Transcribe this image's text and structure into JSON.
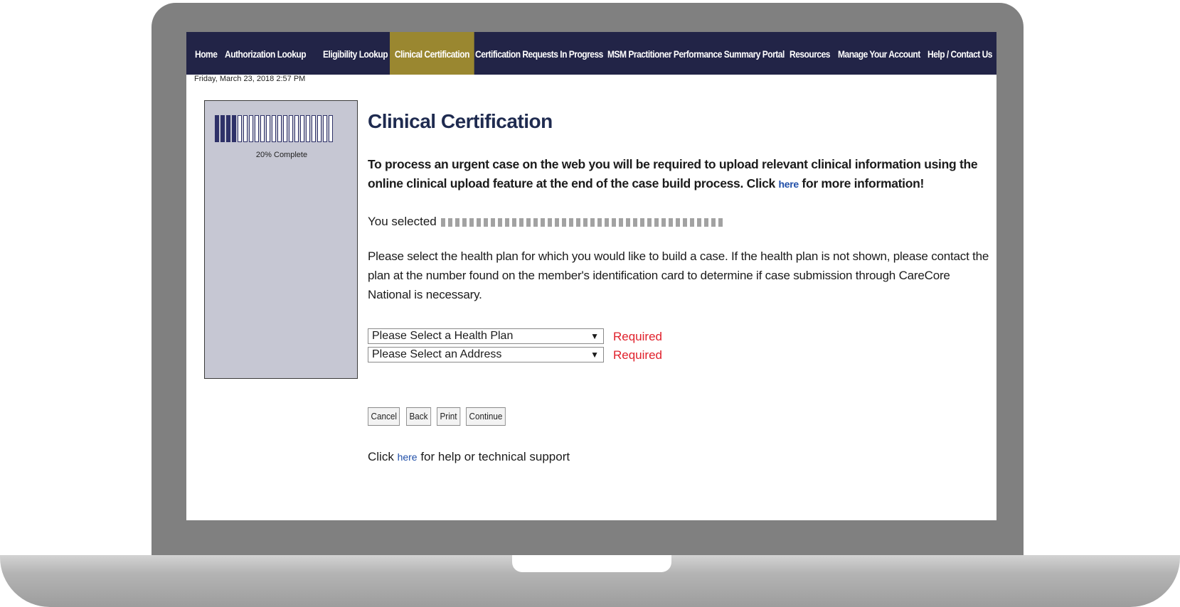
{
  "nav": {
    "items": [
      {
        "label": "Home",
        "active": false
      },
      {
        "label": "Authorization Lookup",
        "active": false
      },
      {
        "label": "Eligibility Lookup",
        "active": false
      },
      {
        "label": "Clinical Certification",
        "active": true
      },
      {
        "label": "Certification Requests In Progress",
        "active": false
      },
      {
        "label": "MSM Practitioner Performance Summary Portal",
        "active": false
      },
      {
        "label": "Resources",
        "active": false
      },
      {
        "label": "Manage Your Account",
        "active": false
      },
      {
        "label": "Help / Contact Us",
        "active": false
      }
    ]
  },
  "datetime": "Friday, March 23, 2018 2:57 PM",
  "progress": {
    "label": "20% Complete",
    "percent": 20,
    "total_segments": 21,
    "filled_segments": 4
  },
  "main": {
    "title": "Clinical Certification",
    "notice_before": "To process an urgent case on the web you will be required to upload relevant clinical information using the online clinical upload feature at the end of the case build process. Click ",
    "notice_link": "here",
    "notice_after": " for more information!",
    "selected_prefix": "You selected",
    "instructions": "Please select the health plan for which you would like to build a case. If the health plan is not shown, please contact the plan at the number found on the member's identification card to determine if case submission through CareCore National is necessary.",
    "health_plan_select": {
      "value": "Please Select a Health Plan",
      "required": "Required"
    },
    "address_select": {
      "value": "Please Select an Address",
      "required": "Required"
    },
    "buttons": {
      "cancel": "Cancel",
      "back": "Back",
      "print": "Print",
      "continue": "Continue"
    },
    "help_before": "Click ",
    "help_link": "here",
    "help_after": " for help or technical support"
  },
  "colors": {
    "nav_bg": "#222447",
    "nav_active": "#9a8730",
    "title": "#1f2b50",
    "required": "#e0202b",
    "progress_fill": "#2e3168",
    "panel_bg": "#c6c7d3"
  }
}
